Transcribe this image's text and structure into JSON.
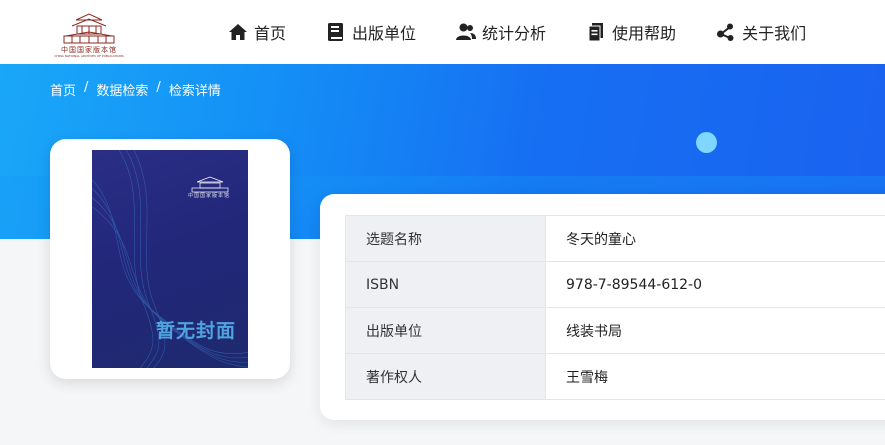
{
  "logo": {
    "name": "中国国家版本馆",
    "subtitle": "CHINA NATIONAL ARCHIVES OF PUBLICATIONS"
  },
  "nav": [
    {
      "label": "首页",
      "icon": "home-icon"
    },
    {
      "label": "出版单位",
      "icon": "book-icon"
    },
    {
      "label": "统计分析",
      "icon": "users-icon"
    },
    {
      "label": "使用帮助",
      "icon": "document-icon"
    },
    {
      "label": "关于我们",
      "icon": "share-icon"
    }
  ],
  "breadcrumb": {
    "home": "首页",
    "search": "数据检索",
    "detail": "检索详情",
    "separator": "/"
  },
  "cover": {
    "placeholder_text": "暂无封面",
    "logo_text": "中国国家版本馆"
  },
  "details": [
    {
      "label": "选题名称",
      "value": "冬天的童心"
    },
    {
      "label": "ISBN",
      "value": "978-7-89544-612-0"
    },
    {
      "label": "出版单位",
      "value": "线装书局"
    },
    {
      "label": "著作权人",
      "value": "王雪梅"
    }
  ],
  "colors": {
    "banner_start": "#1aa7f8",
    "banner_end": "#1a62f0",
    "logo_red": "#8b2a22",
    "label_bg": "#eef0f4"
  }
}
